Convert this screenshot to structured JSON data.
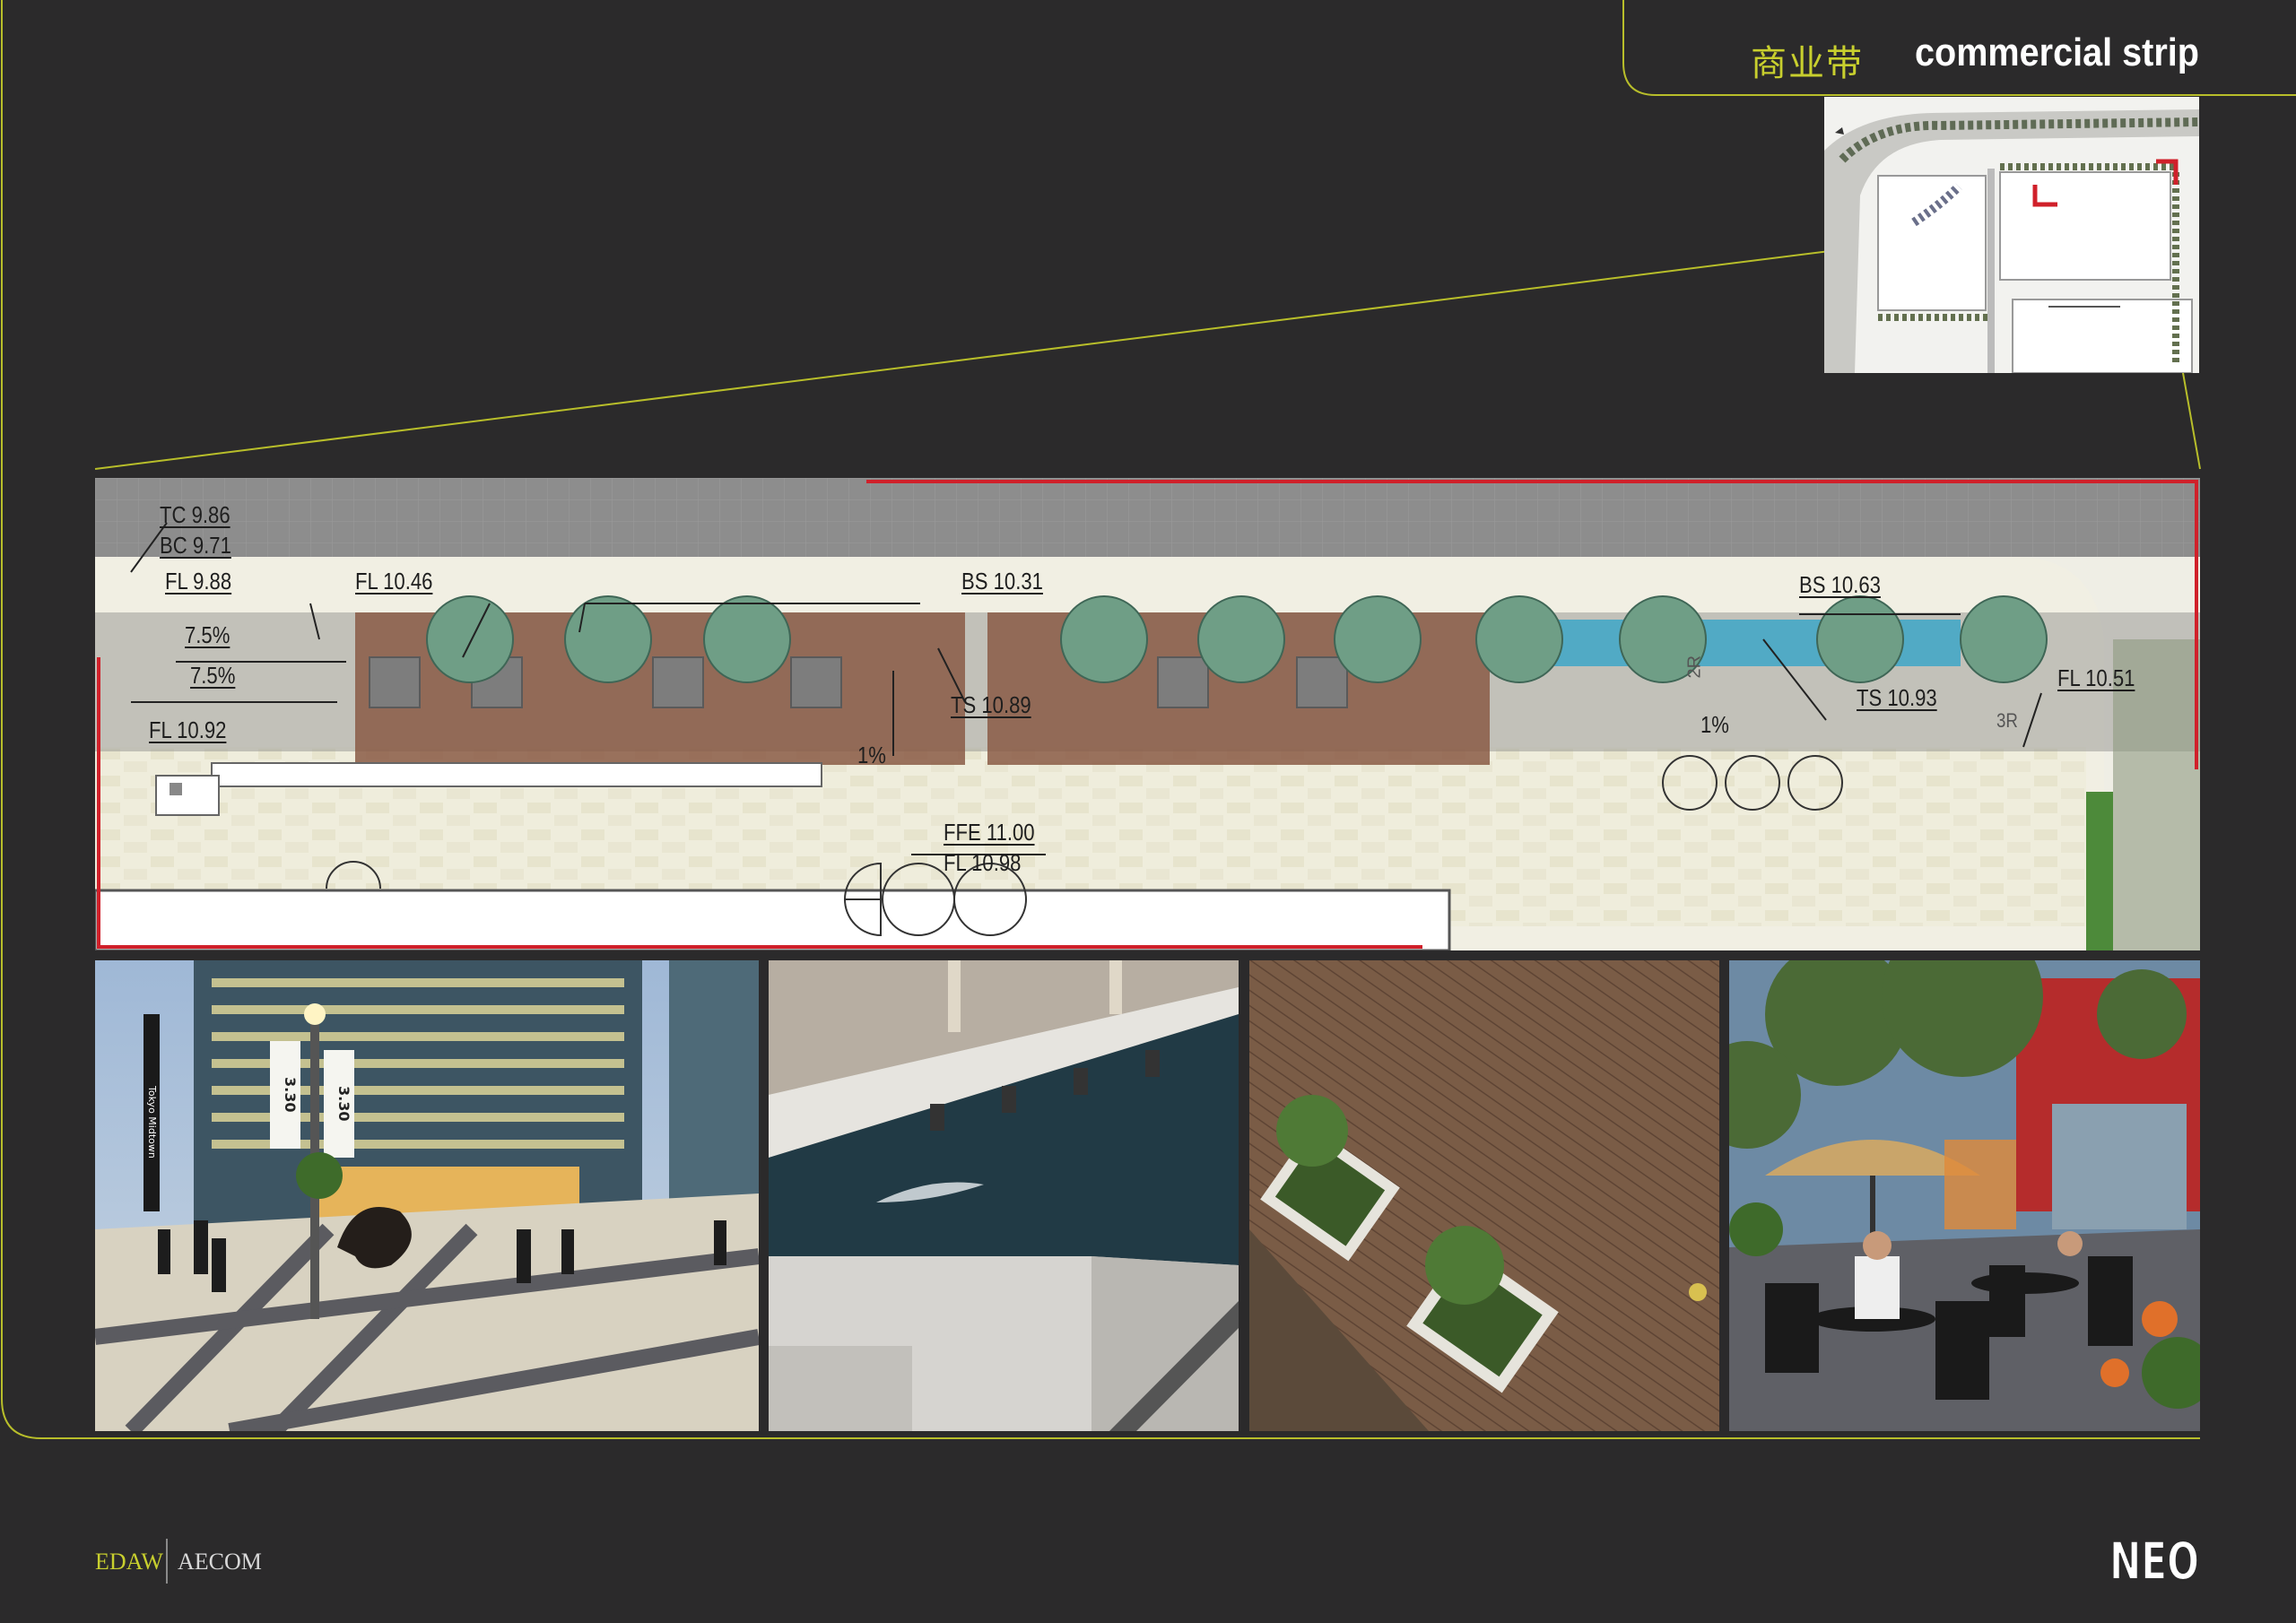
{
  "header": {
    "title_cn": "商业带",
    "title_en": "commercial strip"
  },
  "plan": {
    "labels": {
      "tc": "TC 9.86",
      "bc": "BC 9.71",
      "fl1": "FL  9.88",
      "fl2": "FL 10.46",
      "slope1": "7.5%",
      "slope2": "7.5%",
      "fl3": "FL 10.92",
      "bs1": "BS 10.31",
      "ts1": "TS  10.89",
      "pct1": "1%",
      "ffe": "FFE 11.00",
      "fl4": "FL 10.98",
      "bs2": "BS 10.63",
      "ts2": "TS 10.93",
      "pct2": "1%",
      "fl5": "FL 10.51",
      "riser1": "2R",
      "riser2": "3R"
    }
  },
  "photos": [
    {
      "name": "photo-plaza-evening",
      "banner1": "3.30",
      "banner2": "3.30",
      "pole": "Tokyo Midtown"
    },
    {
      "name": "photo-water-channel"
    },
    {
      "name": "photo-wood-deck-planters"
    },
    {
      "name": "photo-outdoor-cafe"
    }
  ],
  "footer": {
    "edaw": "EDAW",
    "aecom": "AECOM",
    "logo": "NEO"
  },
  "colors": {
    "background": "#2b2a2b",
    "accent_lime": "#c8cf2e",
    "highlight_red": "#d0202a"
  }
}
